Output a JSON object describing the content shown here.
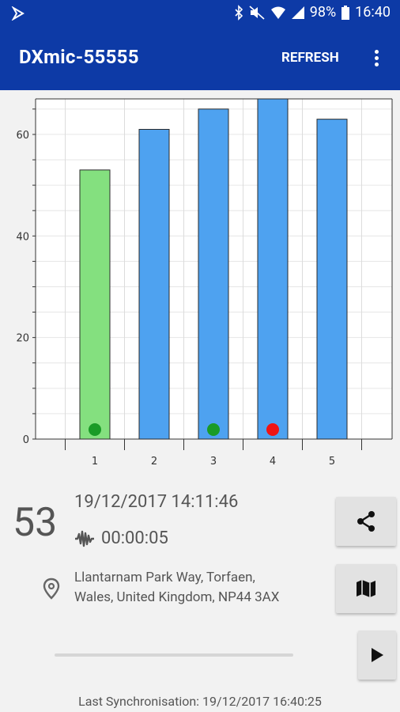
{
  "status_bar": {
    "battery": "98%",
    "time": "16:40"
  },
  "app_bar": {
    "title": "DXmic-55555",
    "refresh_label": "REFRESH"
  },
  "chart_data": {
    "type": "bar",
    "categories": [
      "1",
      "2",
      "3",
      "4",
      "5"
    ],
    "values": [
      53,
      61,
      65,
      67,
      63
    ],
    "bar_colors": [
      "#84e07f",
      "#4ea2f0",
      "#4ea2f0",
      "#4ea2f0",
      "#4ea2f0"
    ],
    "markers": [
      {
        "category": "1",
        "color": "#1a9b27"
      },
      {
        "category": "3",
        "color": "#1a9b27"
      },
      {
        "category": "4",
        "color": "#f01414"
      }
    ],
    "ylim": [
      0,
      67
    ],
    "y_ticks": [
      "0",
      "20",
      "40",
      "60"
    ],
    "grid": true
  },
  "recording": {
    "level": "53",
    "datetime": "19/12/2017 14:11:46",
    "duration": "00:00:05",
    "address_line1": "Llantarnam Park Way, Torfaen,",
    "address_line2": "Wales, United Kingdom, NP44 3AX",
    "playback_progress": 0
  },
  "sync_text": "Last Synchronisation: 19/12/2017 16:40:25",
  "icons": {
    "share": "share-icon",
    "map": "map-icon",
    "play": "play-icon",
    "location": "location-pin-icon",
    "waveform": "waveform-icon"
  },
  "colors": {
    "primary": "#0d3aa6",
    "background": "#f2f2f2"
  }
}
